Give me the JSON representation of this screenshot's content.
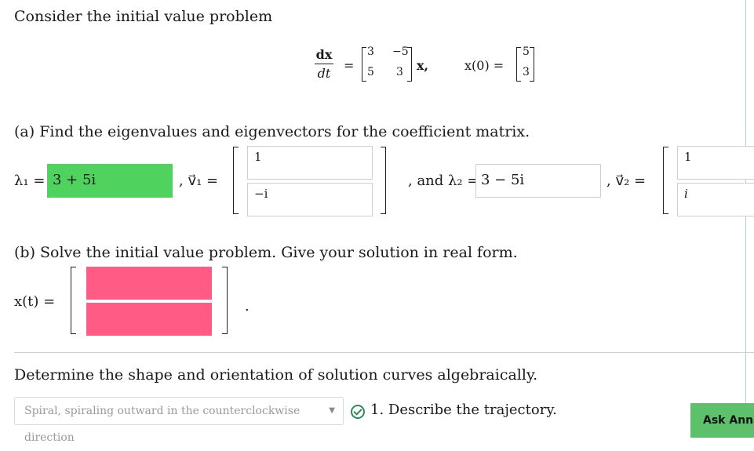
{
  "intro": "Consider the initial value problem",
  "equation": {
    "deriv_num": "dx",
    "deriv_den": "dt",
    "equals": "=",
    "matrix": [
      "3",
      "−5",
      "5",
      "3"
    ],
    "times": "x,",
    "ic_label": "x(0) =",
    "ic_vector": [
      "5",
      "3"
    ]
  },
  "part_a": {
    "prompt": "(a) Find the eigenvalues and eigenvectors for the coefficient matrix.",
    "lambda1_label": "λ₁ =",
    "lambda1_value": "3 + 5i",
    "v1_label": ", v⃗₁ =",
    "v1": [
      "1",
      "−i"
    ],
    "and_label": ", and λ₂ =",
    "lambda2_value": "3 − 5i",
    "v2_label": ", v⃗₂ =",
    "v2": [
      "1",
      "i"
    ]
  },
  "part_b": {
    "prompt": "(b) Solve the initial value problem. Give your solution in real form.",
    "x_label": "x(t) =",
    "x_entries": [
      "",
      ""
    ],
    "period": "."
  },
  "part_c": {
    "prompt": "Determine the shape and orientation of solution curves algebraically.",
    "select_value": "Spiral, spiraling outward in the counterclockwise direction",
    "describe_label": "1. Describe the trajectory."
  },
  "ask_button": "Ask Anna",
  "colors": {
    "correct": "#4fd35e",
    "incorrect": "#ff5b85",
    "accent_line": "#a8d8dc"
  }
}
